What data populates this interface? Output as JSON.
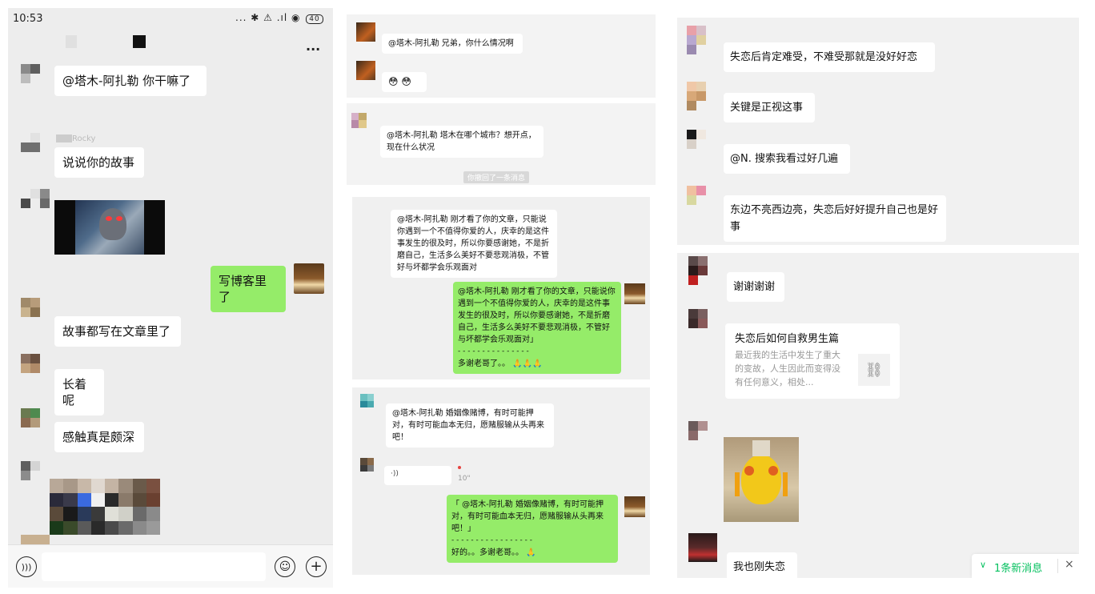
{
  "left": {
    "status_time": "10:53",
    "status_icons": "... ✱ ⚠ .ıl ◉",
    "battery": "40",
    "more": "...",
    "msgs": [
      "@塔木-阿扎勒  你干嘛了",
      "说说你的故事",
      "写博客里了",
      "故事都写在文章里了",
      "长着呢",
      "感触真是颇深"
    ],
    "name_rocky": "Rocky",
    "voice_icon": "voice-icon",
    "emoji_icon": "smiley-icon",
    "plus_icon": "plus-icon"
  },
  "middle": {
    "m1": "@塔木-阿扎勒 兄弟，你什么情况啊",
    "m2": "😳 😳",
    "m3": "@塔木-阿扎勒 塔木在哪个城市？想开点，现在什么状况",
    "recall": "你撤回了一条消息",
    "m4": "@塔木-阿扎勒 刚才看了你的文章，只能说你遇到一个不值得你爱的人，庆幸的是这件事发生的很及时，所以你要感谢她，不是折磨自己，生活多么美好不要悲观消极，不管好与坏都学会乐观面对",
    "m5_quote": "@塔木-阿扎勒 刚才看了你的文章，只能说你遇到一个不值得你爱的人，庆幸的是这件事发生的很及时，所以你要感谢她，不是折磨自己，生活多么美好不要悲观消极，不管好与坏都学会乐观面对」",
    "m5_sep": "- - - - - - - - - - - - - - -",
    "m5_reply": "多谢老哥了。。",
    "m6": "@塔木-阿扎勒 婚姻像赌博，有时可能押对，有时可能血本无归，愿赌服输从头再来吧！",
    "voice_len": "10\"",
    "m7_quote": "「         @塔木-阿扎勒 婚姻像赌博，有时可能押对，有时可能血本无归，愿赌服输从头再来吧！」",
    "m7_sep": "- - - - - - - - - - - - - - - - -",
    "m7_reply": "好的。。多谢老哥。。"
  },
  "right": {
    "r1": "失恋后肯定难受，不难受那就是没好好恋",
    "r2": "关键是正视这事",
    "r3": "@N. 搜索我看过好几遍",
    "r4": "东边不亮西边亮，失恋后好好提升自己也是好事",
    "r5": "谢谢谢谢",
    "link_title": "失恋后如何自救男生篇",
    "link_desc": "最近我的生活中发生了重大的变故，人生因此而变得没有任何意义，相处...",
    "link_icon": "link-icon",
    "r6": "我也刚失恋",
    "new_msg": "1条新消息",
    "close": "×"
  },
  "colors": {
    "green": "#95ec69",
    "bg": "#ededed",
    "accent": "#07c160"
  }
}
